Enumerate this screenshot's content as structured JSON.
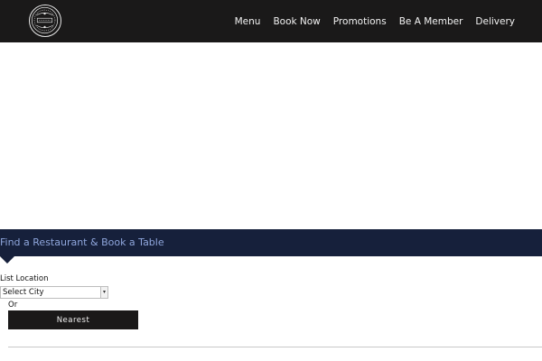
{
  "header": {
    "logo_icon": "pizza-express-logo-icon",
    "nav": [
      {
        "label": "Menu"
      },
      {
        "label": "Book Now"
      },
      {
        "label": "Promotions"
      },
      {
        "label": "Be A Member"
      },
      {
        "label": "Delivery"
      }
    ]
  },
  "finder": {
    "title": "Find a Restaurant & Book a Table",
    "list_location_label": "List Location",
    "city_select": {
      "selected": "Select City",
      "icon": "chevron-down-icon"
    },
    "or_label": "Or",
    "nearest_label": "Nearest"
  },
  "colors": {
    "header_bg": "#1a1919",
    "finder_bar_bg": "#16203b",
    "finder_title": "#8fa6dc",
    "button_bg": "#1a1919"
  }
}
